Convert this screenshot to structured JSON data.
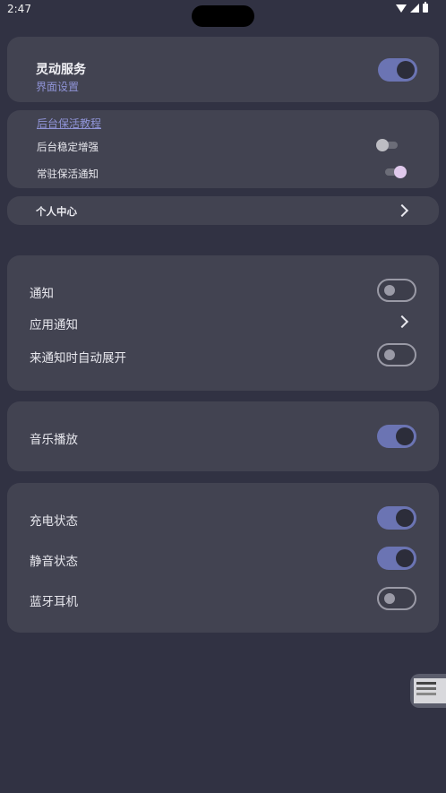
{
  "status_bar": {
    "time": "2:47",
    "icons": [
      "wifi-icon",
      "signal-icon",
      "battery-icon"
    ]
  },
  "service_card": {
    "title": "灵动服务",
    "subtitle": "界面设置",
    "toggle_on": true
  },
  "keepalive_card": {
    "tutorial_link": "后台保活教程",
    "items": [
      {
        "label": "后台稳定增强",
        "on": false
      },
      {
        "label": "常驻保活通知",
        "on": true
      }
    ]
  },
  "personal_center": {
    "label": "个人中心"
  },
  "notification_card": {
    "items": [
      {
        "label": "通知",
        "type": "toggle",
        "on": false
      },
      {
        "label": "应用通知",
        "type": "link"
      },
      {
        "label": "来通知时自动展开",
        "type": "toggle",
        "on": false
      }
    ]
  },
  "music_card": {
    "label": "音乐播放",
    "on": true
  },
  "status_card": {
    "items": [
      {
        "label": "充电状态",
        "on": true
      },
      {
        "label": "静音状态",
        "on": true
      },
      {
        "label": "蓝牙耳机",
        "on": false
      }
    ]
  },
  "colors": {
    "background": "#313243",
    "card": "#424351",
    "accent": "#6b74b3",
    "link": "#8f93d6"
  }
}
